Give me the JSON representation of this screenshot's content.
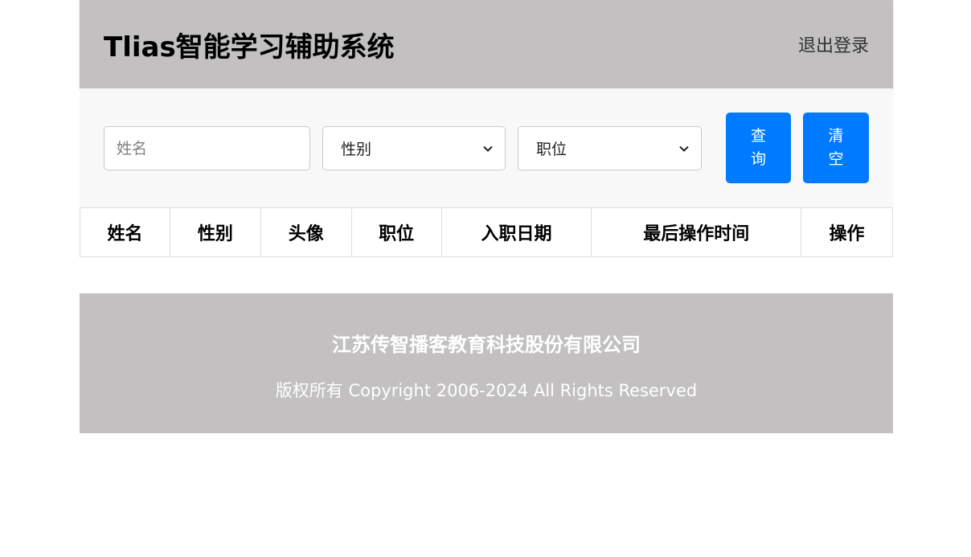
{
  "header": {
    "title": "Tlias智能学习辅助系统",
    "logout_label": "退出登录"
  },
  "search": {
    "name_placeholder": "姓名",
    "gender_selected": "性别",
    "job_selected": "职位",
    "query_label": "查询",
    "clear_label": "清空"
  },
  "table": {
    "columns": [
      "姓名",
      "性别",
      "头像",
      "职位",
      "入职日期",
      "最后操作时间",
      "操作"
    ],
    "rows": []
  },
  "footer": {
    "company": "江苏传智播客教育科技股份有限公司",
    "copyright": "版权所有 Copyright 2006-2024 All Rights Reserved"
  },
  "colors": {
    "header_bg": "#c2c0c1",
    "button_primary": "#007bff",
    "search_bg": "#f8f8f8"
  }
}
